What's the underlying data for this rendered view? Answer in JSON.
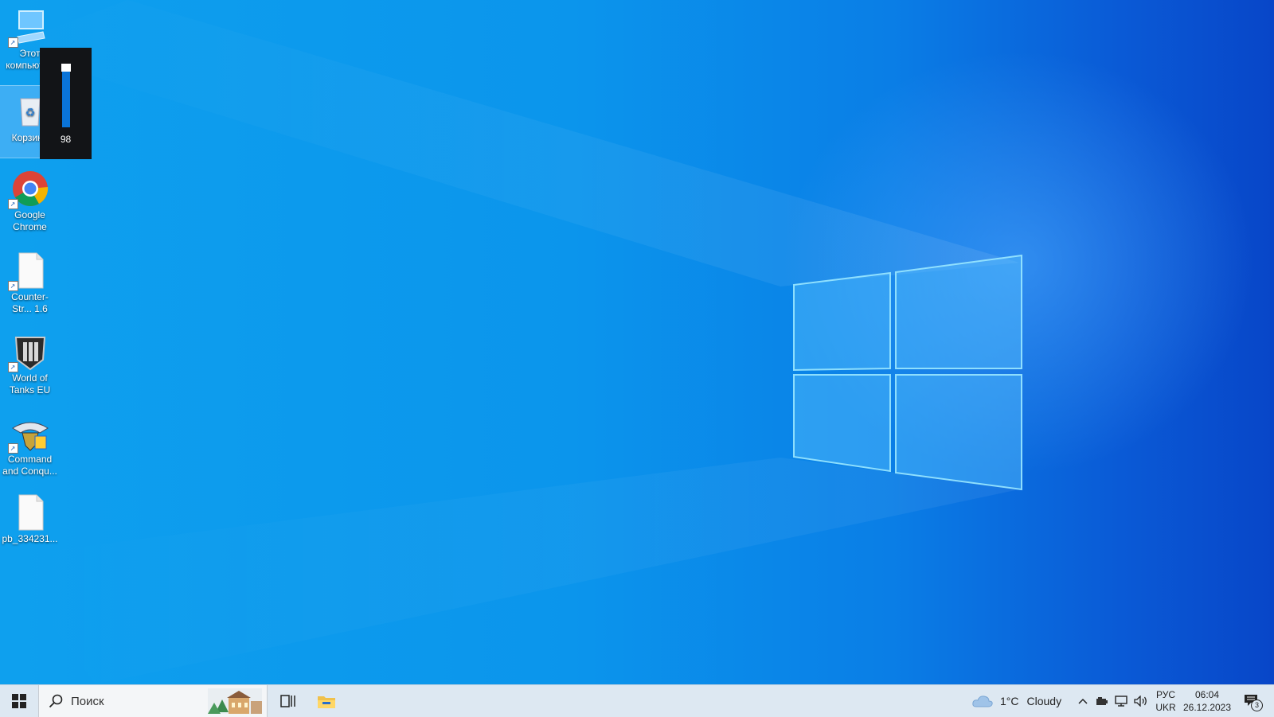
{
  "desktop": {
    "icons": [
      {
        "label": "Этот компьютер",
        "icon": "computer-icon"
      },
      {
        "label": "Корзина",
        "icon": "recycle-bin-icon"
      },
      {
        "label": "Google Chrome",
        "icon": "chrome-icon"
      },
      {
        "label": "Counter-Str... 1.6",
        "icon": "blank-file-icon"
      },
      {
        "label": "World of Tanks EU",
        "icon": "world-of-tanks-icon"
      },
      {
        "label": "Command and Conqu...",
        "icon": "command-and-conquer-icon"
      },
      {
        "label": "pb_334231...",
        "icon": "blank-file-icon"
      }
    ]
  },
  "volume": {
    "value": "98",
    "level": 0.98
  },
  "taskbar": {
    "search_placeholder": "Поиск",
    "weather": {
      "temp": "1°C",
      "condition": "Cloudy",
      "icon": "cloud-icon"
    },
    "language": {
      "top": "РУС",
      "bottom": "UKR"
    },
    "clock": {
      "time": "06:04",
      "date": "26.12.2023"
    },
    "notifications_count": "3"
  },
  "colors": {
    "accent": "#0a74d8",
    "flyout": "#121417",
    "taskbar": "#dde8f2"
  }
}
